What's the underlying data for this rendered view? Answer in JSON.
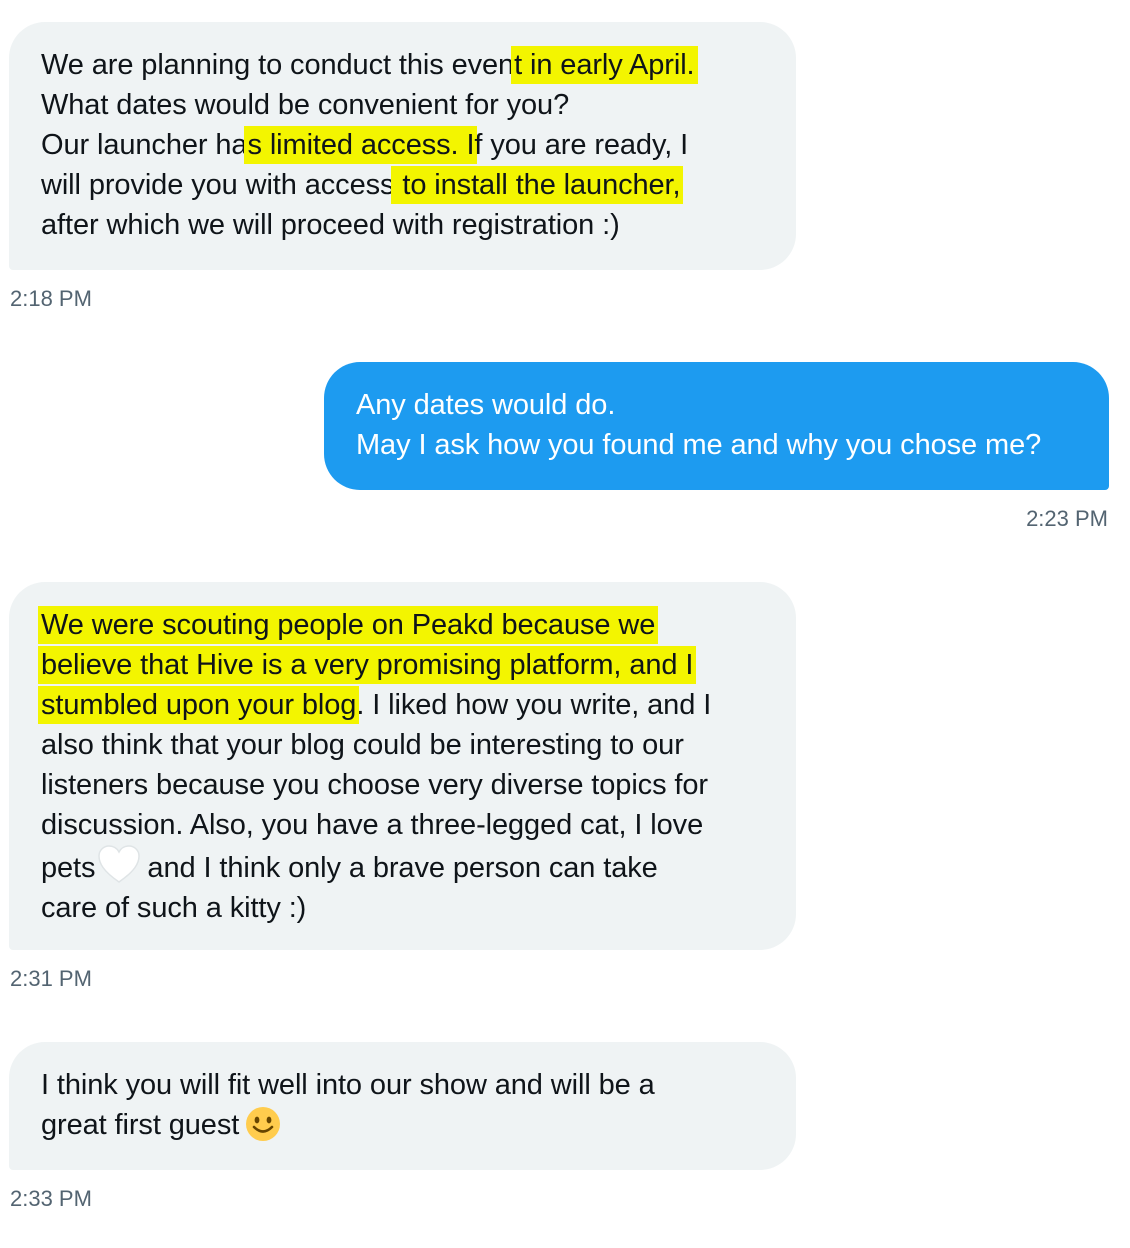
{
  "messages": [
    {
      "direction": "incoming",
      "lines": [
        [
          "We are planning to conduct this even",
          "t in early April."
        ],
        [
          "What dates would be convenient for you?"
        ],
        [
          "Our launcher ha",
          "s limited access. I",
          "f you are ready, I"
        ],
        [
          "will provide you with access",
          " to install the launcher,"
        ],
        [
          "after which we will proceed with registration :)"
        ]
      ],
      "time": "2:18 PM"
    },
    {
      "direction": "outgoing",
      "lines": [
        "Any dates would do.",
        "May I ask how you found me and why you chose me?"
      ],
      "time": "2:23 PM"
    },
    {
      "direction": "incoming",
      "lines": [
        "We were scouting people on Peakd because we",
        "believe that Hive is a very promising platform, and I",
        "stumbled upon your blog",
        ". I liked how you write, and I",
        "also think that your blog could be interesting to our",
        "listeners because you choose very diverse topics for",
        "discussion. Also, you have a three-legged cat, I love",
        "pets",
        "and I think only a brave person can take",
        "care of such a kitty :)"
      ],
      "time": "2:31 PM"
    },
    {
      "direction": "incoming",
      "lines": [
        "I think you will fit well into our show and will be a",
        "great first guest"
      ],
      "time": "2:33 PM"
    }
  ],
  "colors": {
    "incoming_bubble": "#eff3f4",
    "outgoing_bubble": "#1d9bf0",
    "highlight": "#f3f500",
    "timestamp": "#536471"
  },
  "icons": [
    "white-heart-emoji",
    "slightly-smiling-face-emoji"
  ]
}
